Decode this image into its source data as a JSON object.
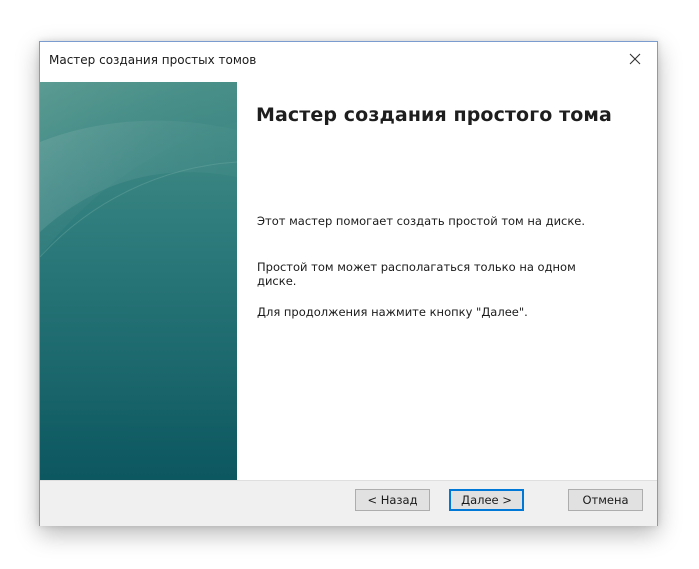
{
  "window": {
    "title": "Мастер создания простых томов",
    "close_symbol": "✕"
  },
  "content": {
    "heading": "Мастер создания простого тома",
    "paragraph1": "Этот мастер помогает создать простой том на диске.",
    "paragraph2": "Простой том может располагаться только на одном диске.",
    "paragraph3": "Для продолжения нажмите кнопку \"Далее\"."
  },
  "buttons": {
    "back_label": "< Назад",
    "next_label": "Далее >",
    "cancel_label": "Отмена"
  },
  "colors": {
    "accent": "#0078d7",
    "side_panel_top": "#3f8a82",
    "side_panel_bottom": "#0d5a62",
    "footer": "#f0f0f0"
  },
  "icons": {
    "close": "close-icon"
  }
}
